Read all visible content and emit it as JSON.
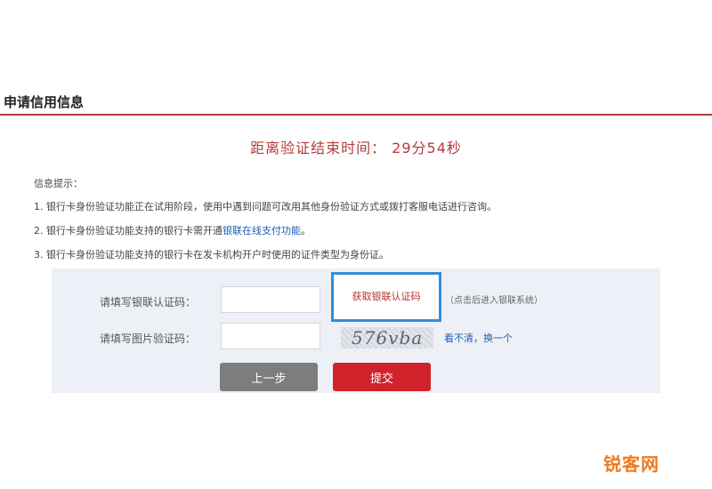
{
  "section_title": "申请信用信息",
  "countdown": "距离验证结束时间： 29分54秒",
  "tips": {
    "title": "信息提示：",
    "items": [
      {
        "text": "1. 银行卡身份验证功能正在试用阶段，使用中遇到问题可改用其他身份验证方式或拨打客服电话进行咨询。",
        "link": ""
      },
      {
        "text": "2. 银行卡身份验证功能支持的银行卡需开通",
        "link": "银联在线支付功能",
        "suffix": "。"
      },
      {
        "text": "3. 银行卡身份验证功能支持的银行卡在发卡机构开户时使用的证件类型为身份证。",
        "link": ""
      }
    ]
  },
  "form": {
    "unionpay_code_label": "请填写银联认证码：",
    "unionpay_code_value": "",
    "get_code_button": "获取银联认证码",
    "get_code_hint": "（点击后进入银联系统）",
    "captcha_label": "请填写图片验证码：",
    "captcha_value": "",
    "captcha_image_text": "576vba",
    "refresh_link": "看不清，换一个",
    "prev_button": "上一步",
    "submit_button": "提交"
  },
  "watermark": "锐客网",
  "colors": {
    "accent_red": "#d0222a",
    "countdown_red": "#b53a3a",
    "highlight_blue": "#2f8fd8",
    "link_blue": "#1a5fb4"
  }
}
